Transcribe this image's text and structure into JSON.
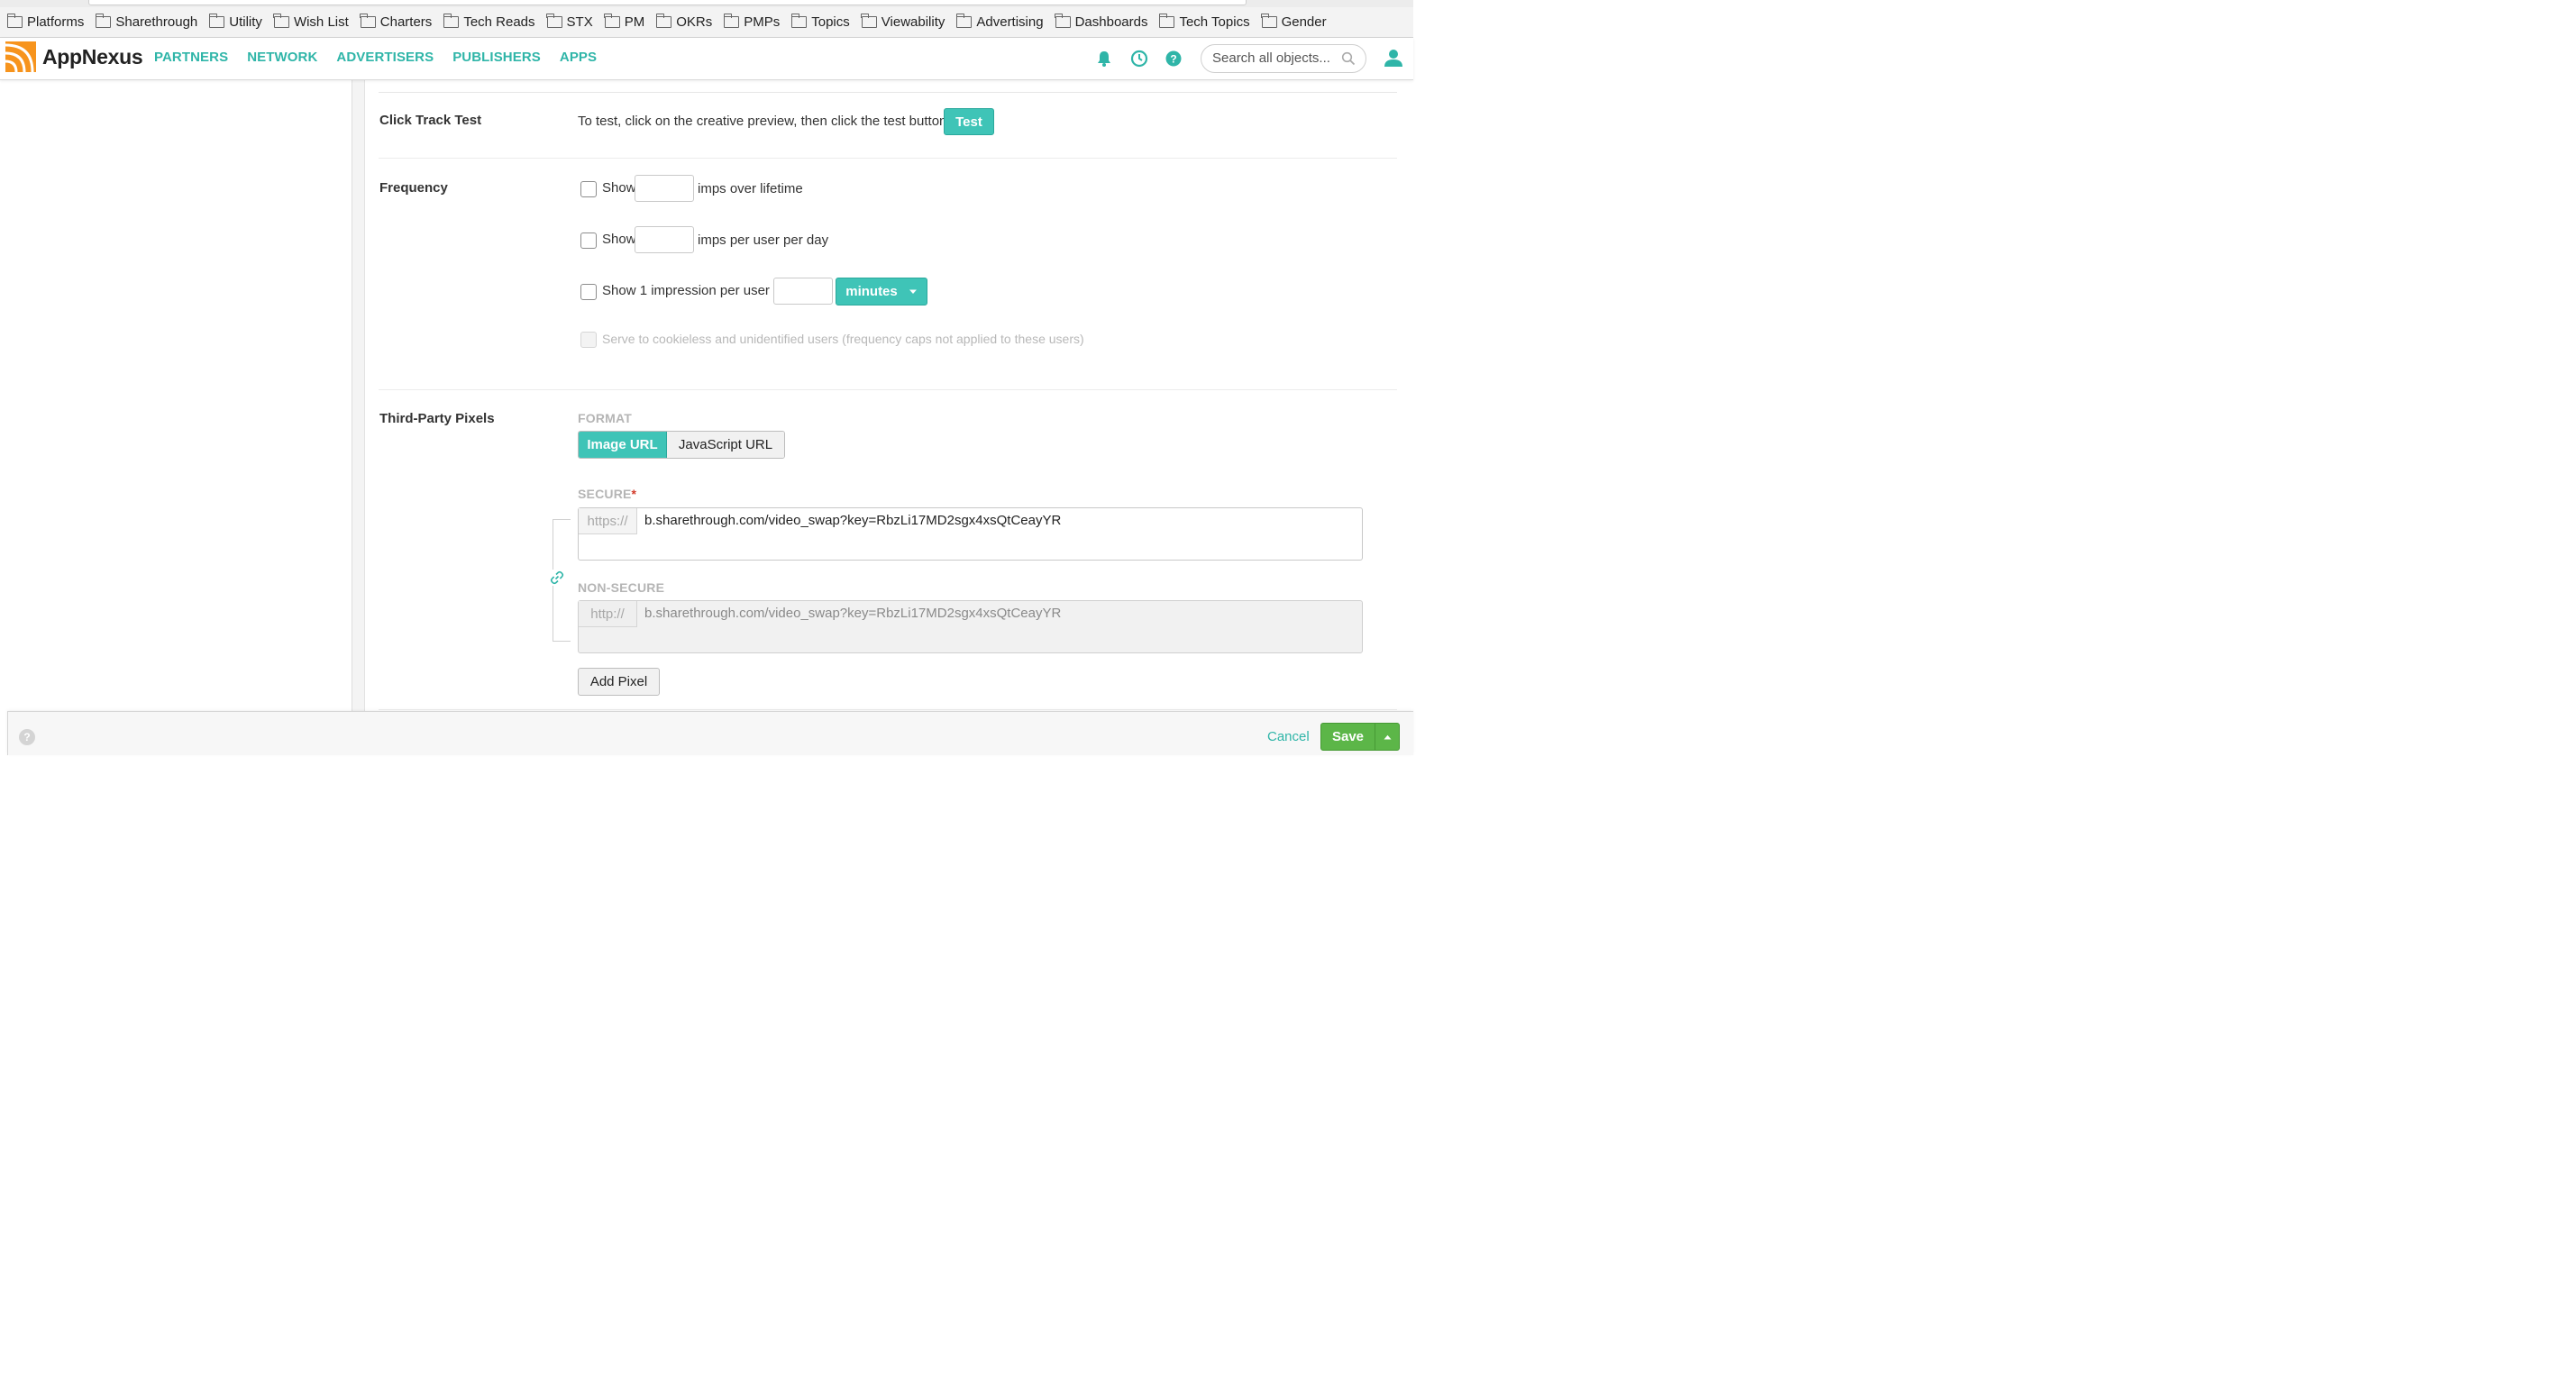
{
  "bookmarks": [
    "Platforms",
    "Sharethrough",
    "Utility",
    "Wish List",
    "Charters",
    "Tech Reads",
    "STX",
    "PM",
    "OKRs",
    "PMPs",
    "Topics",
    "Viewability",
    "Advertising",
    "Dashboards",
    "Tech Topics",
    "Gender"
  ],
  "header": {
    "brand": "AppNexus",
    "nav": [
      "PARTNERS",
      "NETWORK",
      "ADVERTISERS",
      "PUBLISHERS",
      "APPS"
    ],
    "search_placeholder": "Search all objects...",
    "accent": "#2fb5a8"
  },
  "click_track": {
    "label": "Click Track Test",
    "instructions": "To test, click on the creative preview, then click the test button:",
    "button": "Test"
  },
  "frequency": {
    "label": "Frequency",
    "row1_prefix": "Show",
    "row1_suffix": "imps over lifetime",
    "row2_prefix": "Show",
    "row2_suffix": "imps per user per day",
    "row3_prefix": "Show 1 impression per user per",
    "unit": "minutes",
    "cookieless": "Serve to cookieless and unidentified users (frequency caps not applied to these users)"
  },
  "pixels": {
    "label": "Third-Party Pixels",
    "format_label": "FORMAT",
    "format_options": [
      "Image URL",
      "JavaScript URL"
    ],
    "secure_label": "SECURE",
    "required_mark": "*",
    "secure_prefix": "https://",
    "secure_value": "b.sharethrough.com/video_swap?key=RbzLi17MD2sgx4xsQtCeayYR",
    "nonsecure_label": "NON-SECURE",
    "nonsecure_prefix": "http://",
    "nonsecure_value": "b.sharethrough.com/video_swap?key=RbzLi17MD2sgx4xsQtCeayYR",
    "add_button": "Add Pixel"
  },
  "footer": {
    "help": "?",
    "cancel": "Cancel",
    "save": "Save"
  }
}
